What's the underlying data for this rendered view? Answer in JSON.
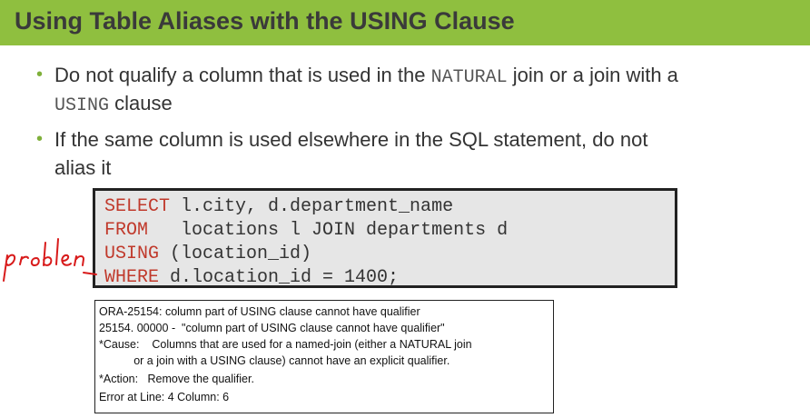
{
  "header": {
    "title": "Using Table Aliases with the USING Clause"
  },
  "bullets": [
    {
      "line1_a": "Do not qualify a column that is used in the ",
      "line1_code": "NATURAL",
      "line1_b": " join or a join with a",
      "line2_code": "USING",
      "line2_b": " clause"
    },
    {
      "line1": "If the same column is used elsewhere in the SQL statement, do not",
      "line2": "alias it"
    }
  ],
  "code": {
    "lines": [
      {
        "keyword": "SELECT",
        "rest": " l.city, d.department_name"
      },
      {
        "keyword": "FROM",
        "rest": "   locations l JOIN departments d"
      },
      {
        "keyword": "USING",
        "rest": " (location_id)"
      },
      {
        "keyword": "WHERE",
        "rest": " d.location_id = 1400;"
      }
    ]
  },
  "error": {
    "lines": [
      "ORA-25154: column part of USING clause cannot have qualifier",
      "25154. 00000 -  \"column part of USING clause cannot have qualifier\"",
      "*Cause:    Columns that are used for a named-join (either a NATURAL join",
      "           or a join with a USING clause) cannot have an explicit qualifier.",
      "*Action:   Remove the qualifier.",
      "Error at Line: 4 Column: 6"
    ]
  },
  "annotation": {
    "handwritten_text": "problem"
  },
  "colors": {
    "title_bar": "#8fbf3f",
    "keyword": "#c0392b",
    "handwriting": "#d81b1b",
    "bullet": "#7fb03a"
  }
}
